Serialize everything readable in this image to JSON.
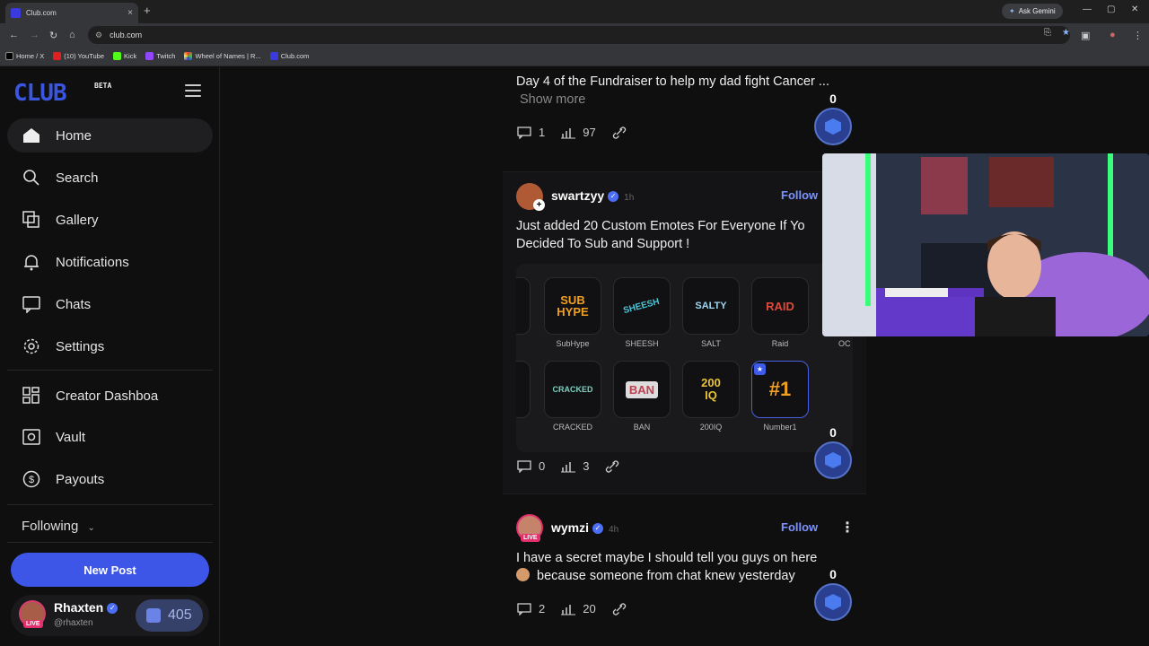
{
  "browser": {
    "tab_title": "Club.com",
    "tab_close": "×",
    "new_tab": "+",
    "ask_gemini": "Ask Gemini",
    "url": "club.com",
    "bookmarks": [
      "Home / X",
      "(10) YouTube",
      "Kick",
      "Twitch",
      "Wheel of Names | R...",
      "Club.com"
    ]
  },
  "sidebar": {
    "logo": "CLUB",
    "logo_tag": "BETA",
    "nav": [
      {
        "label": "Home",
        "icon": "home-icon"
      },
      {
        "label": "Search",
        "icon": "search-icon"
      },
      {
        "label": "Gallery",
        "icon": "gallery-icon"
      },
      {
        "label": "Notifications",
        "icon": "bell-icon"
      },
      {
        "label": "Chats",
        "icon": "chat-icon"
      },
      {
        "label": "Settings",
        "icon": "gear-icon"
      },
      {
        "label": "Creator Dashboa",
        "icon": "dashboard-icon"
      },
      {
        "label": "Vault",
        "icon": "vault-icon"
      },
      {
        "label": "Payouts",
        "icon": "dollar-icon"
      }
    ],
    "following": "Following",
    "new_post": "New Post",
    "profile": {
      "name": "Rhaxten",
      "handle": "@rhaxten",
      "live": "LIVE",
      "coins": "405"
    }
  },
  "feed": {
    "post1": {
      "text": "Day 4 of the Fundraiser to help my dad fight Cancer ...",
      "show_more": "Show more",
      "comments": "1",
      "views": "97",
      "tip_count": "0"
    },
    "post2": {
      "username": "swartzyy",
      "ago": "1h",
      "follow": "Follow",
      "text_line1": "Just added 20 Custom Emotes For Everyone If Yo",
      "text_line2": "Decided To Sub and Support !",
      "emotes_row1": [
        {
          "label": "SubHype",
          "art": "SUB HYPE",
          "color": "#f0a020"
        },
        {
          "label": "SHEESH",
          "art": "SHEESH",
          "color": "#4cc6d6"
        },
        {
          "label": "SALT",
          "art": "SALTY",
          "color": "#9fd6f0"
        },
        {
          "label": "Raid",
          "art": "RAID",
          "color": "#e04a3a"
        }
      ],
      "emote_partial_label": "OC",
      "emotes_row2": [
        {
          "label": "CRACKED",
          "art": "CRACKED",
          "color": "#7dd0c0"
        },
        {
          "label": "BAN",
          "art": "BAN",
          "color": "#c04050"
        },
        {
          "label": "200IQ",
          "art": "200 IQ",
          "color": "#e8c23a"
        },
        {
          "label": "Number1",
          "art": "#1",
          "color": "#f0a020"
        }
      ],
      "comments": "0",
      "views": "3",
      "tip_count": "0"
    },
    "post3": {
      "username": "wymzi",
      "ago": "4h",
      "follow": "Follow",
      "live": "LIVE",
      "text_line1": "I have a secret maybe I should tell you guys on here",
      "text_line2": "because someone from chat knew yesterday",
      "comments": "2",
      "views": "20",
      "tip_count": "0"
    }
  },
  "colors": {
    "accent": "#3d56e8",
    "follow": "#7b93ff",
    "live": "#e1306c"
  }
}
